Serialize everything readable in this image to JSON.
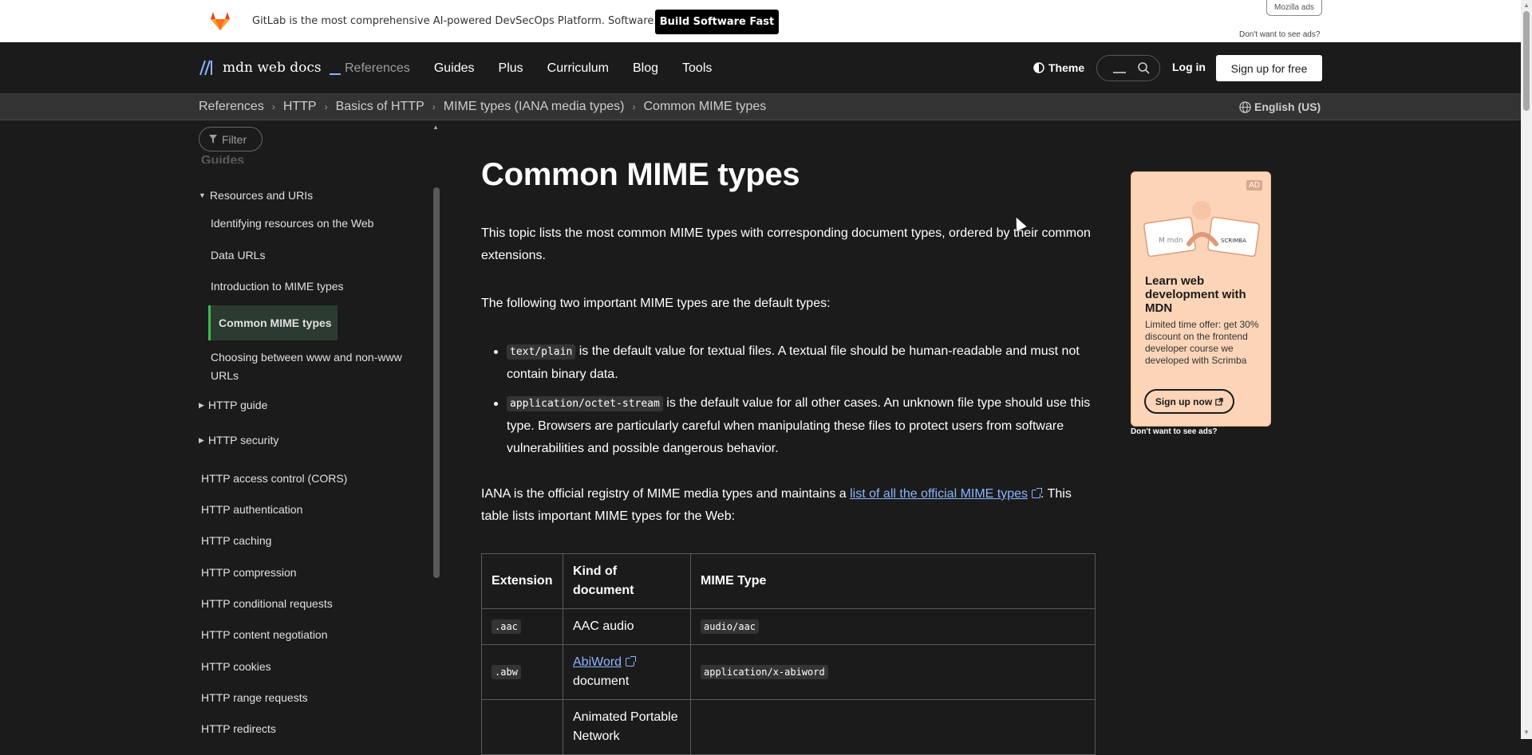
{
  "ad_banner": {
    "text": "GitLab is the most comprehensive AI-powered DevSecOps Platform. Software. Faster.",
    "cta": "Build Software Fast",
    "mozilla_ads": "Mozilla ads",
    "no_ads": "Don't want to see ads?"
  },
  "nav": {
    "logo": "mdn web docs",
    "menu": [
      "References",
      "Guides",
      "Plus",
      "Curriculum",
      "Blog",
      "Tools"
    ],
    "theme": "Theme",
    "login": "Log in",
    "signup": "Sign up for free"
  },
  "breadcrumbs": [
    "References",
    "HTTP",
    "Basics of HTTP",
    "MIME types (IANA media types)",
    "Common MIME types"
  ],
  "language": "English (US)",
  "sidebar": {
    "filter_placeholder": "Filter",
    "cut_heading": "Guides",
    "section_resources": "Resources and URIs",
    "resource_items": [
      "Identifying resources on the Web",
      "Data URLs",
      "Introduction to MIME types",
      "Common MIME types",
      "Choosing between www and non-www URLs"
    ],
    "collapsed_sections": [
      "HTTP guide",
      "HTTP security"
    ],
    "items": [
      "HTTP access control (CORS)",
      "HTTP authentication",
      "HTTP caching",
      "HTTP compression",
      "HTTP conditional requests",
      "HTTP content negotiation",
      "HTTP cookies",
      "HTTP range requests",
      "HTTP redirects"
    ]
  },
  "article": {
    "title": "Common MIME types",
    "intro": "This topic lists the most common MIME types with corresponding document types, ordered by their common extensions.",
    "defaults_intro": "The following two important MIME types are the default types:",
    "bullet1_code": "text/plain",
    "bullet1_text": " is the default value for textual files. A textual file should be human-readable and must not contain binary data.",
    "bullet2_code": "application/octet-stream",
    "bullet2_text": " is the default value for all other cases. An unknown file type should use this type. Browsers are particularly careful when manipulating these files to protect users from software vulnerabilities and possible dangerous behavior.",
    "iana_before": "IANA is the official registry of MIME media types and maintains a ",
    "iana_link": "list of all the official MIME types",
    "iana_after": ". This table lists important MIME types for the Web:",
    "table": {
      "headers": [
        "Extension",
        "Kind of document",
        "MIME Type"
      ],
      "rows": [
        {
          "ext": ".aac",
          "kind": "AAC audio",
          "mime": "audio/aac"
        },
        {
          "ext": ".abw",
          "kind_link": "AbiWord",
          "kind": "document",
          "mime": "application/x-abiword"
        },
        {
          "ext": "",
          "kind": "Animated Portable Network",
          "mime": ""
        }
      ]
    }
  },
  "side_ad": {
    "tag": "AD",
    "title": "Learn web development with MDN",
    "desc": "Limited time offer: get 30% discount on the frontend developer course we developed with Scrimba",
    "button": "Sign up now",
    "no_ads": "Don't want to see ads?"
  }
}
